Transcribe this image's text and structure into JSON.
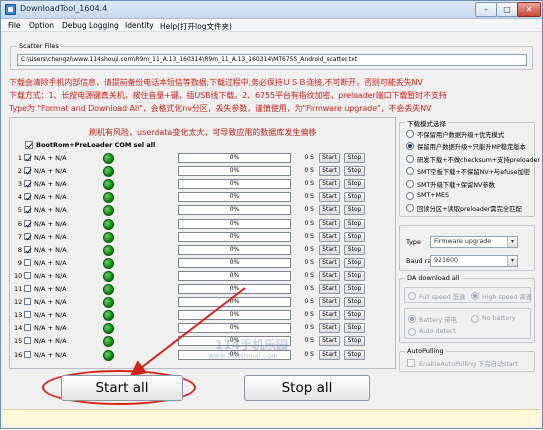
{
  "window": {
    "title": "DownloadTool_1604.4"
  },
  "menu": [
    "File",
    "Option",
    "Debug Logging",
    "Identity",
    "Help(打开log文件夹)"
  ],
  "scatter": {
    "legend": "Scatter Files",
    "path": "C:\\Users\\chengzi\\www.114shouji.com\\R9m_11_A.13_160314\\R9m_11_A.13_160314\\MT6755_Android_scatter.txt"
  },
  "warnings": [
    "下载会清除手机内部信息，请提前备份电话本短信等数据;下载过程中,务必保持ＵＳＢ连接,不可断开，否则可能丢失NV",
    "下载方式：1、长按电源键真关机，按住音量+键，插USB线下载。2、6755平台有指纹加密，preloader端口下载暂时不支持",
    "Type为 \"Format and Download All\"，会格式化nv分区，丢失参数，谨慎使用，为\"Firmware upgrade\"，不会丢失NV"
  ],
  "ports_panel": {
    "risk_text": "刷机有风险，userdata变化太大，可导致应用的数据库发生偏移",
    "select_all_label": "BootRom+PreLoader COM sel all",
    "select_all_checked": true,
    "ports": [
      {
        "num": "1",
        "name": "N/A + N/A",
        "checked": true,
        "progress_text": "0%",
        "progress": 0,
        "seconds": "0 S",
        "start": "Start",
        "stop": "Stop"
      },
      {
        "num": "2",
        "name": "N/A + N/A",
        "checked": true,
        "progress_text": "0%",
        "progress": 0,
        "seconds": "0 S",
        "start": "Start",
        "stop": "Stop"
      },
      {
        "num": "3",
        "name": "N/A + N/A",
        "checked": true,
        "progress_text": "0%",
        "progress": 0,
        "seconds": "0 S",
        "start": "Start",
        "stop": "Stop"
      },
      {
        "num": "4",
        "name": "N/A + N/A",
        "checked": true,
        "progress_text": "0%",
        "progress": 0,
        "seconds": "0 S",
        "start": "Start",
        "stop": "Stop"
      },
      {
        "num": "5",
        "name": "N/A + N/A",
        "checked": true,
        "progress_text": "0%",
        "progress": 0,
        "seconds": "0 S",
        "start": "Start",
        "stop": "Stop"
      },
      {
        "num": "6",
        "name": "N/A + N/A",
        "checked": true,
        "progress_text": "0%",
        "progress": 0,
        "seconds": "0 S",
        "start": "Start",
        "stop": "Stop"
      },
      {
        "num": "7",
        "name": "N/A + N/A",
        "checked": true,
        "progress_text": "0%",
        "progress": 0,
        "seconds": "0 S",
        "start": "Start",
        "stop": "Stop"
      },
      {
        "num": "8",
        "name": "N/A + N/A",
        "checked": true,
        "progress_text": "0%",
        "progress": 0,
        "seconds": "0 S",
        "start": "Start",
        "stop": "Stop"
      },
      {
        "num": "9",
        "name": "N/A + N/A",
        "checked": false,
        "progress_text": "0%",
        "progress": 0,
        "seconds": "0 S",
        "start": "Start",
        "stop": "Stop"
      },
      {
        "num": "10",
        "name": "N/A + N/A",
        "checked": false,
        "progress_text": "0%",
        "progress": 0,
        "seconds": "0 S",
        "start": "Start",
        "stop": "Stop"
      },
      {
        "num": "11",
        "name": "N/A + N/A",
        "checked": false,
        "progress_text": "0%",
        "progress": 0,
        "seconds": "0 S",
        "start": "Start",
        "stop": "Stop"
      },
      {
        "num": "12",
        "name": "N/A + N/A",
        "checked": false,
        "progress_text": "0%",
        "progress": 0,
        "seconds": "0 S",
        "start": "Start",
        "stop": "Stop"
      },
      {
        "num": "13",
        "name": "N/A + N/A",
        "checked": false,
        "progress_text": "0%",
        "progress": 0,
        "seconds": "0 S",
        "start": "Start",
        "stop": "Stop"
      },
      {
        "num": "14",
        "name": "N/A + N/A",
        "checked": false,
        "progress_text": "0%",
        "progress": 0,
        "seconds": "0 S",
        "start": "Start",
        "stop": "Stop"
      },
      {
        "num": "15",
        "name": "N/A + N/A",
        "checked": false,
        "progress_text": "0%",
        "progress": 0,
        "seconds": "0 S",
        "start": "Start",
        "stop": "Stop"
      },
      {
        "num": "16",
        "name": "N/A + N/A",
        "checked": false,
        "progress_text": "0%",
        "progress": 0,
        "seconds": "0 S",
        "start": "Start",
        "stop": "Stop"
      }
    ]
  },
  "watermark": {
    "logo": "114手机乐园",
    "url": "www.114shouji.com"
  },
  "buttons": {
    "start_all": "Start all",
    "stop_all": "Stop all"
  },
  "download_mode": {
    "legend": "下载模式选择",
    "options": [
      {
        "label": "不保留用户数据升级+优先模式",
        "selected": false
      },
      {
        "label": "保留用户数据升级+只能升MP稳定版本",
        "selected": true
      },
      {
        "label": "研发下载+不做checksum+支持preloader",
        "selected": false
      },
      {
        "label": "SMT空板下载+不保留NV+与efuse加密",
        "selected": false
      },
      {
        "label": "SMT升级下载+保留NV参数",
        "selected": false
      },
      {
        "label": "SMT+MES",
        "selected": false
      },
      {
        "label": "回读分区+读取preloader需完全匹配",
        "selected": false
      }
    ]
  },
  "type_group": {
    "type_label": "Type",
    "type_value": "Firmware upgrade",
    "baud_label": "Baud rate",
    "baud_value": "921600"
  },
  "da_download": {
    "legend": "DA download all",
    "speed_full": "Full speed 低速",
    "speed_high": "High speed 高速",
    "battery": "Battery 带电",
    "no_battery": "No battery",
    "auto_detect": "Auto detect"
  },
  "autopulling": {
    "legend": "AutoPulling",
    "label": "EnableAutoPulling 下完自动start"
  },
  "colors": {
    "warning_red": "#d2221b",
    "led_green": "#1a9a1a",
    "highlight": "#d42318"
  }
}
